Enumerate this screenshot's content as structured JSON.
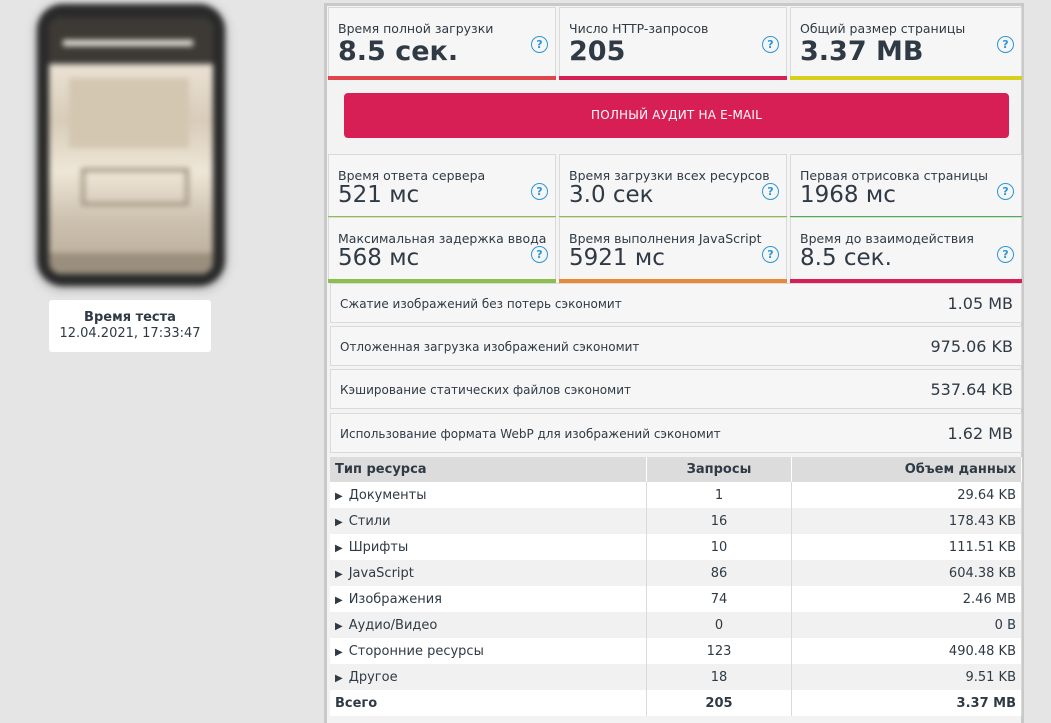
{
  "test_time": {
    "label": "Время теста",
    "value": "12.04.2021, 17:33:47"
  },
  "top_metrics": [
    {
      "label": "Время полной загрузки",
      "value": "8.5 сек.",
      "color": "#e0474c"
    },
    {
      "label": "Число HTTP-запросов",
      "value": "205",
      "color": "#d81f55"
    },
    {
      "label": "Общий размер страницы",
      "value": "3.37 MB",
      "color": "#d6d01c"
    }
  ],
  "audit_button": "ПОЛНЫЙ АУДИТ НА E-MAIL",
  "metrics": [
    {
      "label": "Время ответа сервера",
      "value": "521 мс",
      "color": "#8cbf4c"
    },
    {
      "label": "Время загрузки всех ресурсов",
      "value": "3.0 сек",
      "color": "#8cbf4c"
    },
    {
      "label": "Первая отрисовка страницы",
      "value": "1968 мс",
      "color": "#4caf50"
    },
    {
      "label": "Максимальная задержка ввода",
      "value": "568 мс",
      "color": "#8cbf4c"
    },
    {
      "label": "Время выполнения JavaScript",
      "value": "5921 мс",
      "color": "#e8893a"
    },
    {
      "label": "Время до взаимодействия",
      "value": "8.5 сек.",
      "color": "#d81f55"
    }
  ],
  "help_glyph": "?",
  "savings": [
    {
      "label": "Сжатие изображений без потерь сэкономит",
      "value": "1.05 MB"
    },
    {
      "label": "Отложенная загрузка изображений сэкономит",
      "value": "975.06 KB"
    },
    {
      "label": "Кэширование статических файлов сэкономит",
      "value": "537.64 KB"
    },
    {
      "label": "Использование формата WebP для изображений сэкономит",
      "value": "1.62 MB"
    }
  ],
  "table": {
    "headers": [
      "Тип ресурса",
      "Запросы",
      "Объем данных"
    ],
    "rows": [
      {
        "type": "Документы",
        "requests": "1",
        "size": "29.64 KB"
      },
      {
        "type": "Стили",
        "requests": "16",
        "size": "178.43 KB"
      },
      {
        "type": "Шрифты",
        "requests": "10",
        "size": "111.51 KB"
      },
      {
        "type": "JavaScript",
        "requests": "86",
        "size": "604.38 KB"
      },
      {
        "type": "Изображения",
        "requests": "74",
        "size": "2.46 MB"
      },
      {
        "type": "Аудио/Видео",
        "requests": "0",
        "size": "0 B"
      },
      {
        "type": "Сторонние ресурсы",
        "requests": "123",
        "size": "490.48 KB"
      },
      {
        "type": "Другое",
        "requests": "18",
        "size": "9.51 KB"
      }
    ],
    "total": {
      "type": "Всего",
      "requests": "205",
      "size": "3.37 MB"
    }
  }
}
